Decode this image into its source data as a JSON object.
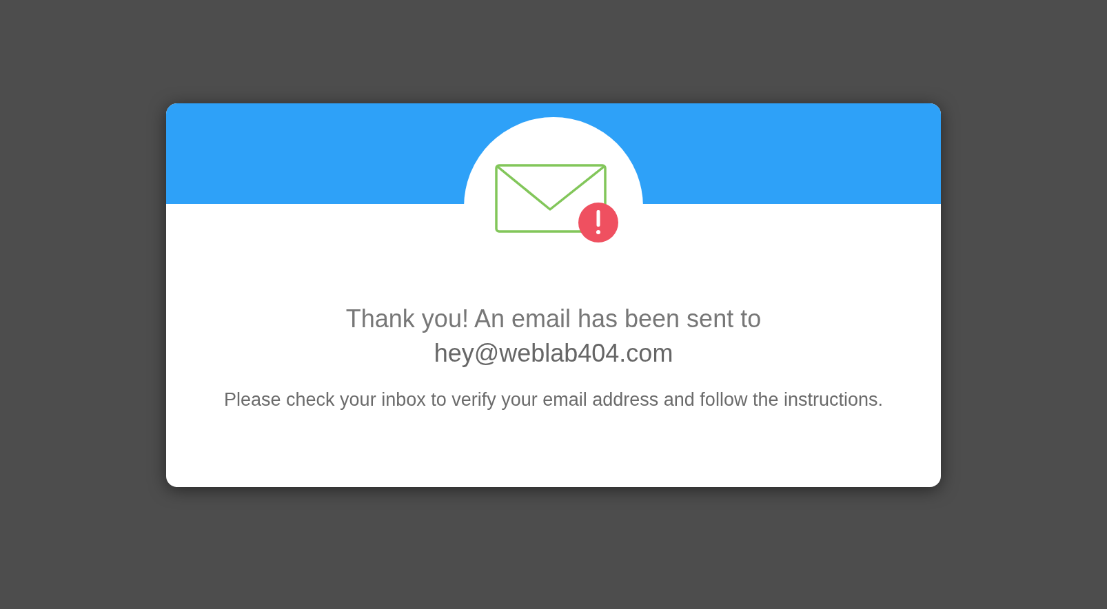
{
  "message": {
    "title": "Thank you! An email has been sent to",
    "email": "hey@weblab404.com",
    "body": "Please check your inbox to verify your email address and follow the instructions."
  }
}
